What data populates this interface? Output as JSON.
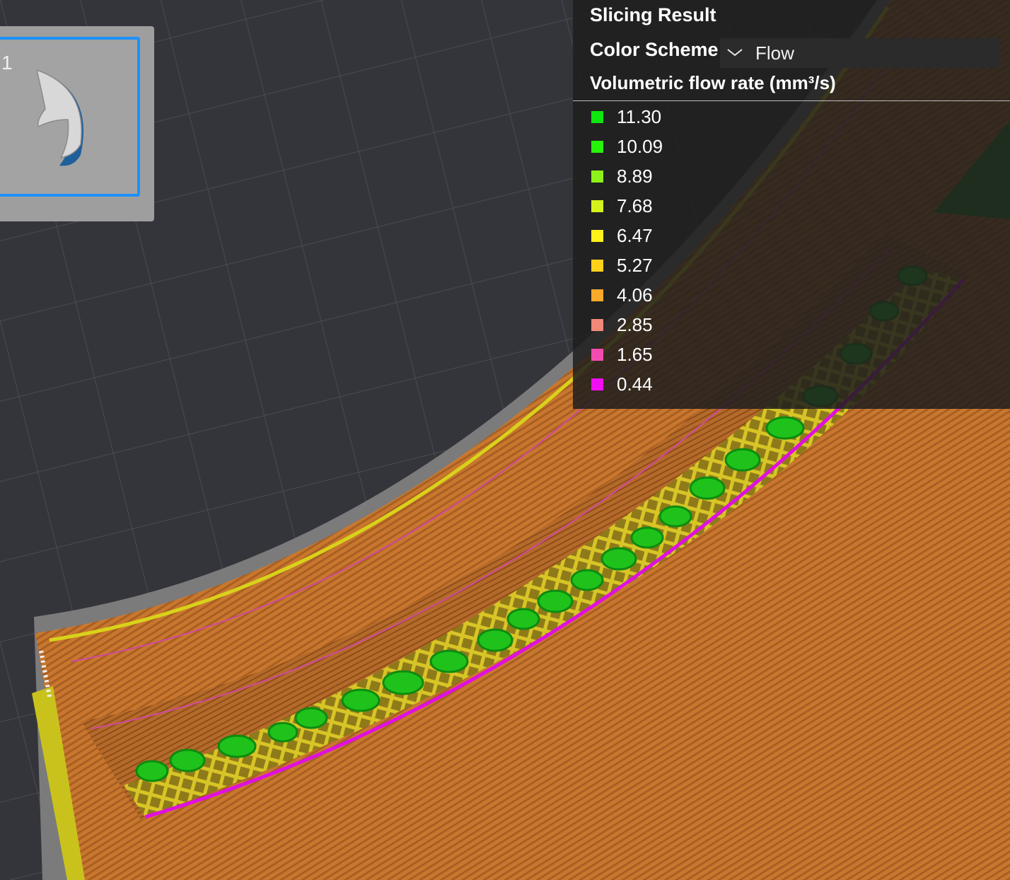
{
  "plate": {
    "number": "1"
  },
  "panel": {
    "title": "Slicing Result",
    "color_scheme_label": "Color Scheme",
    "color_scheme_value": "Flow",
    "subtitle": "Volumetric flow rate (mm³/s)"
  },
  "legend": [
    {
      "value": "11.30",
      "color": "#0ee60e"
    },
    {
      "value": "10.09",
      "color": "#27f20a"
    },
    {
      "value": "8.89",
      "color": "#8ef21a"
    },
    {
      "value": "7.68",
      "color": "#d6f21c"
    },
    {
      "value": "6.47",
      "color": "#fff21a"
    },
    {
      "value": "5.27",
      "color": "#ffd21a"
    },
    {
      "value": "4.06",
      "color": "#fbaa2a"
    },
    {
      "value": "2.85",
      "color": "#f28878"
    },
    {
      "value": "1.65",
      "color": "#f24cb0"
    },
    {
      "value": "0.44",
      "color": "#f20ef2"
    }
  ],
  "colors": {
    "background": "#34353b",
    "grid": "#4a4b52",
    "print_orange": "#c9772e",
    "print_dark_orange": "#b0621f",
    "accent_blue": "#1e90ff"
  }
}
